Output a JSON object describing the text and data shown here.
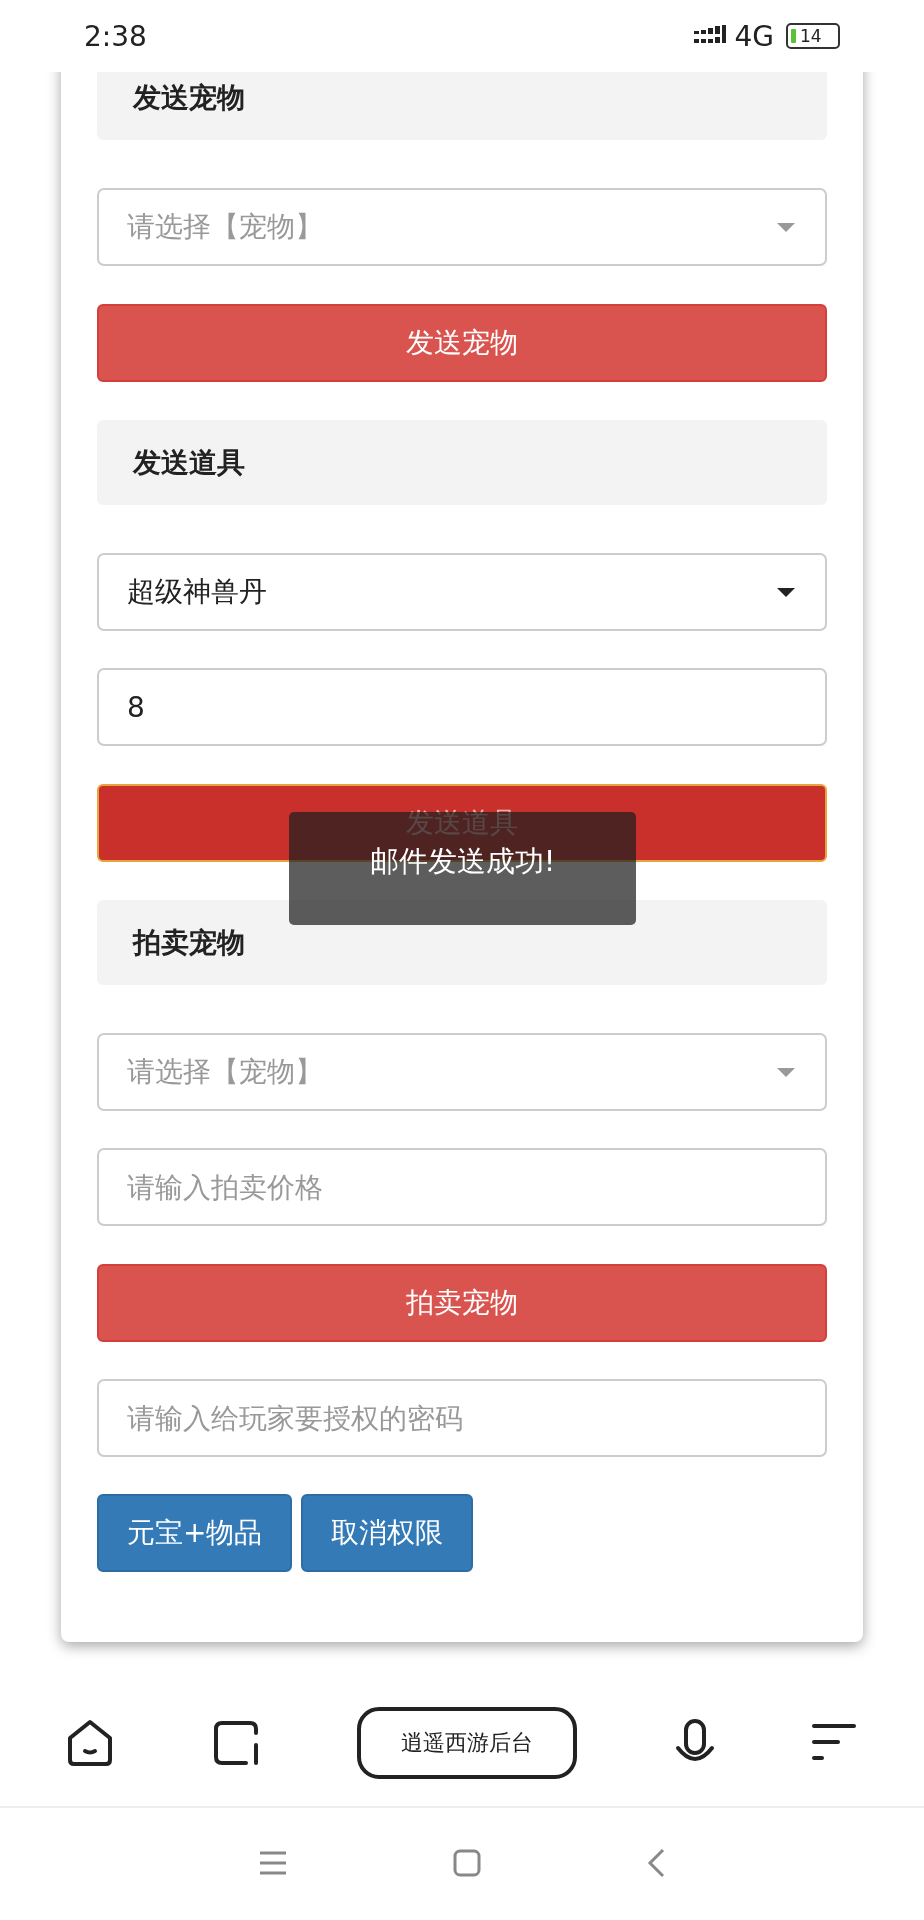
{
  "status_bar": {
    "time": "2:38",
    "network": "4G",
    "battery": "14"
  },
  "form": [
    {
      "kind": "heading",
      "text": "发送宠物"
    },
    {
      "kind": "select",
      "placeholder": "请选择【宠物】"
    },
    {
      "kind": "button",
      "label": "发送宠物",
      "focused": false
    },
    {
      "kind": "heading",
      "text": "发送道具"
    },
    {
      "kind": "select",
      "value": "超级神兽丹"
    },
    {
      "kind": "input",
      "value": "8"
    },
    {
      "kind": "button",
      "label": "发送道具",
      "focused": true
    },
    {
      "kind": "heading",
      "text": "拍卖宠物"
    },
    {
      "kind": "select",
      "placeholder": "请选择【宠物】"
    },
    {
      "kind": "input",
      "placeholder": "请输入拍卖价格"
    },
    {
      "kind": "button",
      "label": "拍卖宠物",
      "focused": false
    },
    {
      "kind": "input",
      "placeholder": "请输入给玩家要授权的密码"
    },
    {
      "kind": "button_row",
      "buttons": [
        "元宝+物品",
        "取消权限"
      ]
    }
  ],
  "toast": "邮件发送成功!",
  "browser_bar": {
    "title": "逍遥西游后台"
  }
}
